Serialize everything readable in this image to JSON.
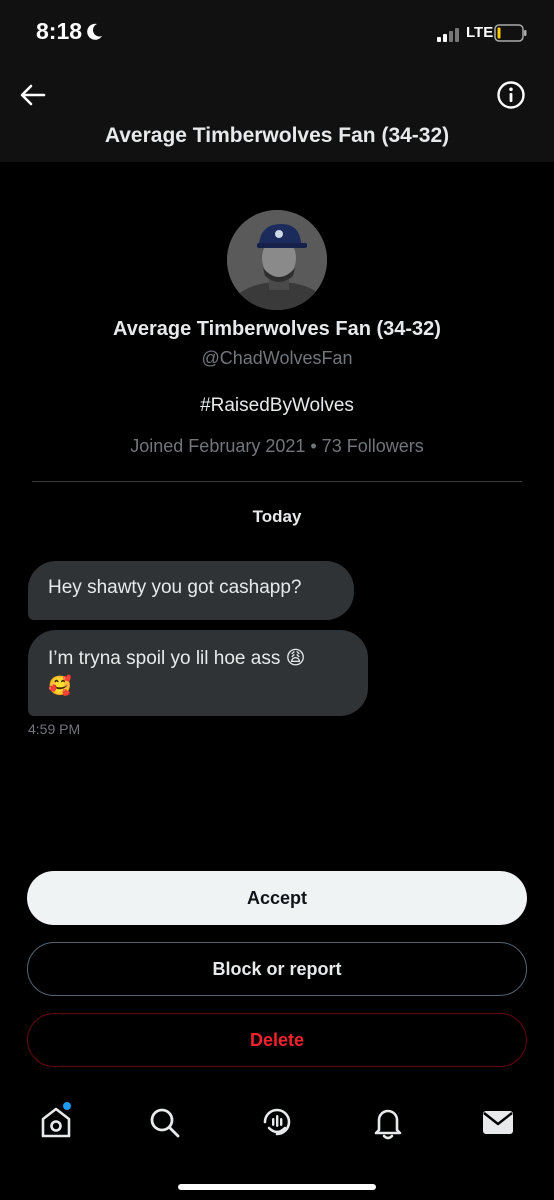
{
  "status_bar": {
    "time": "8:18",
    "network": "LTE"
  },
  "header": {
    "title": "Average Timberwolves Fan (34-32)"
  },
  "profile": {
    "name": "Average Timberwolves Fan (34-32)",
    "handle": "@ChadWolvesFan",
    "bio": "#RaisedByWolves",
    "meta": "Joined February 2021 • 73 Followers"
  },
  "conversation": {
    "day_label": "Today",
    "messages": [
      {
        "text": "Hey shawty you got cashapp?"
      },
      {
        "text_line1": "I’m tryna spoil yo lil hoe ass 😩",
        "text_line2": "🥰"
      }
    ],
    "timestamp": "4:59 PM"
  },
  "actions": {
    "accept": "Accept",
    "block": "Block or report",
    "delete": "Delete"
  },
  "nav": {
    "items": [
      "home-icon",
      "search-icon",
      "spaces-icon",
      "notifications-icon",
      "messages-icon"
    ]
  },
  "colors": {
    "accent": "#1d9bf0",
    "delete": "#f4212e",
    "bubble": "#2f3336"
  }
}
